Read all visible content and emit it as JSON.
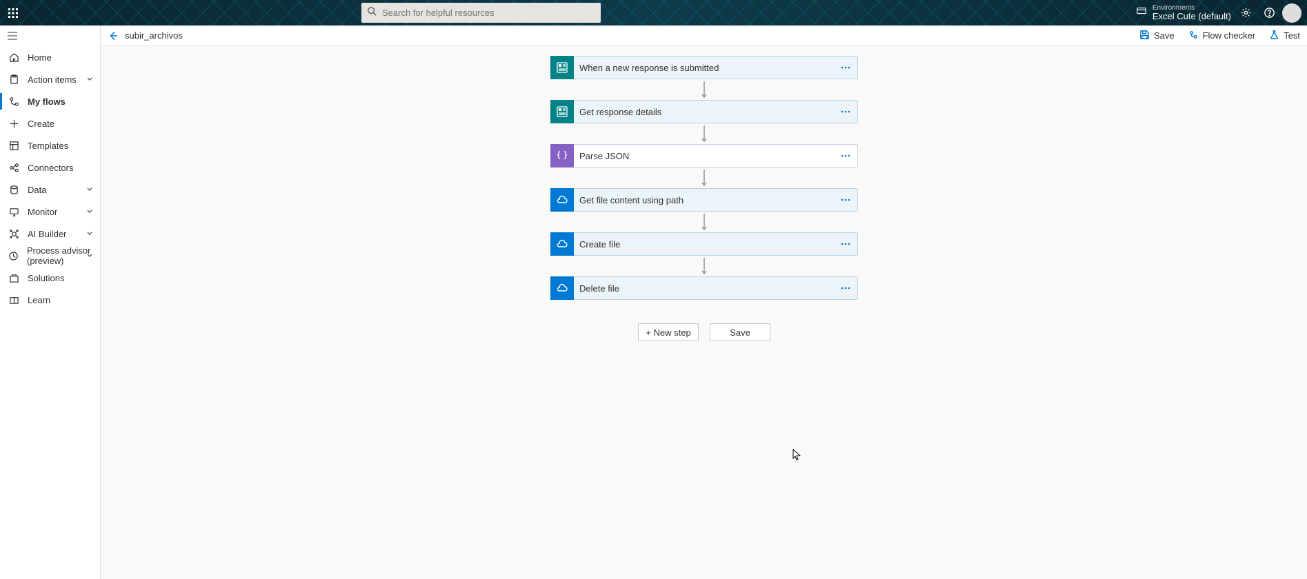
{
  "header": {
    "search_placeholder": "Search for helpful resources",
    "env_label": "Environments",
    "env_name": "Excel Cute (default)"
  },
  "sidebar": {
    "items": [
      {
        "label": "Home",
        "icon": "home",
        "expandable": false,
        "active": false
      },
      {
        "label": "Action items",
        "icon": "clipboard",
        "expandable": true,
        "active": false
      },
      {
        "label": "My flows",
        "icon": "flow",
        "expandable": false,
        "active": true
      },
      {
        "label": "Create",
        "icon": "plus",
        "expandable": false,
        "active": false
      },
      {
        "label": "Templates",
        "icon": "template",
        "expandable": false,
        "active": false
      },
      {
        "label": "Connectors",
        "icon": "connector",
        "expandable": false,
        "active": false
      },
      {
        "label": "Data",
        "icon": "data",
        "expandable": true,
        "active": false
      },
      {
        "label": "Monitor",
        "icon": "monitor",
        "expandable": true,
        "active": false
      },
      {
        "label": "AI Builder",
        "icon": "ai",
        "expandable": true,
        "active": false
      },
      {
        "label": "Process advisor (preview)",
        "icon": "process",
        "expandable": true,
        "active": false
      },
      {
        "label": "Solutions",
        "icon": "solutions",
        "expandable": false,
        "active": false
      },
      {
        "label": "Learn",
        "icon": "learn",
        "expandable": false,
        "active": false
      }
    ]
  },
  "cmdbar": {
    "flow_name": "subir_archivos",
    "save": "Save",
    "flow_checker": "Flow checker",
    "test": "Test"
  },
  "flow": {
    "steps": [
      {
        "title": "When a new response is submitted",
        "color": "teal",
        "icon": "forms"
      },
      {
        "title": "Get response details",
        "color": "teal",
        "icon": "forms"
      },
      {
        "title": "Parse JSON",
        "color": "purple",
        "icon": "braces"
      },
      {
        "title": "Get file content using path",
        "color": "blue",
        "icon": "cloud"
      },
      {
        "title": "Create file",
        "color": "blue",
        "icon": "cloud"
      },
      {
        "title": "Delete file",
        "color": "blue",
        "icon": "cloud"
      }
    ],
    "new_step": "+ New step",
    "save_btn": "Save"
  }
}
